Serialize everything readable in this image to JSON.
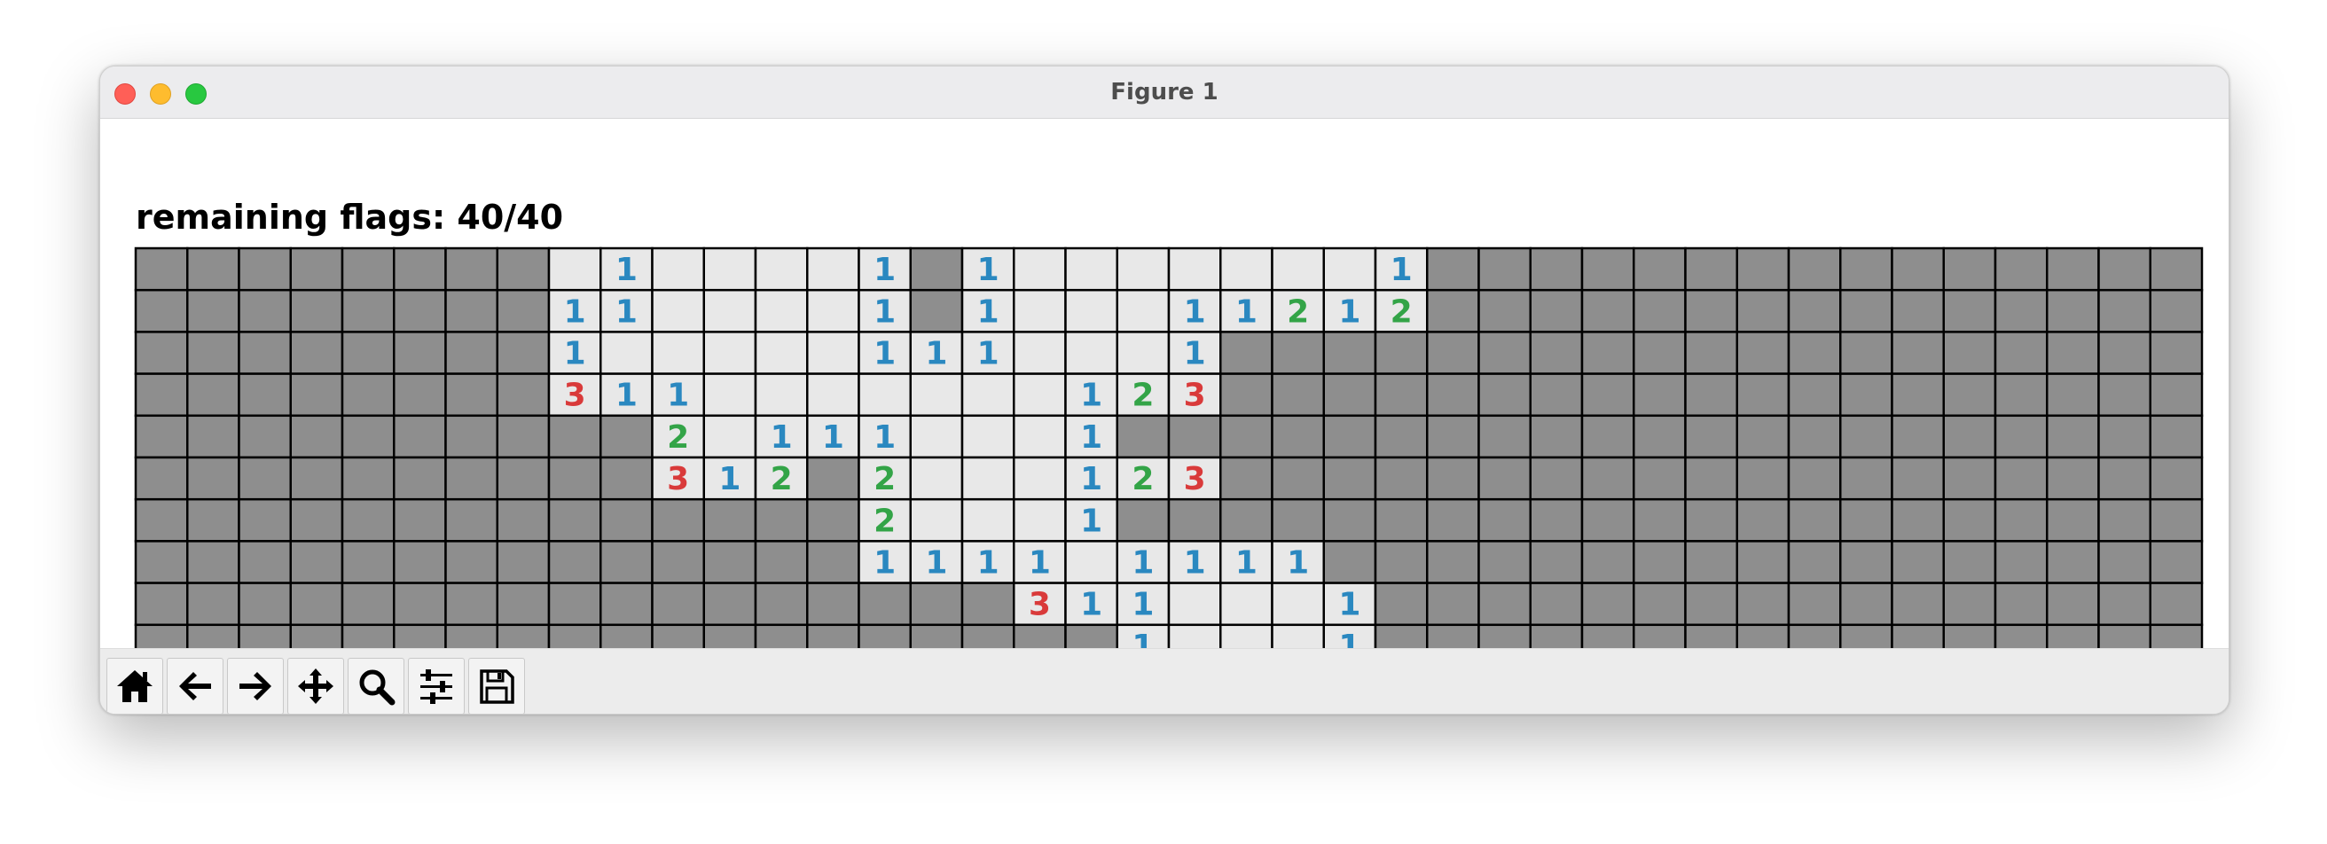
{
  "window": {
    "title": "Figure 1"
  },
  "status": {
    "flags_label": "remaining flags: 40/40"
  },
  "board": {
    "rows": [
      "########.1....1#1.......1###############",
      "########11....1#1...11212###############",
      "########1.....111...1###################",
      "########311.......123###################",
      "##########2.111...1#####################",
      "##########312#2...123###################",
      "##############2...1#####################",
      "##############1111.1111#################",
      "#################311...1################",
      "###################1...1################"
    ],
    "colors": {
      "covered": "#8e8e8e",
      "revealed": "#e8e8e8",
      "grid": "#000000",
      "n1": "#2a88c0",
      "n2": "#33a447",
      "n3": "#d93a3a"
    }
  },
  "toolbar": {
    "buttons": [
      {
        "name": "home-button",
        "icon": "home-icon"
      },
      {
        "name": "back-button",
        "icon": "arrow-left-icon"
      },
      {
        "name": "forward-button",
        "icon": "arrow-right-icon"
      },
      {
        "name": "pan-button",
        "icon": "move-icon"
      },
      {
        "name": "zoom-button",
        "icon": "magnifier-icon"
      },
      {
        "name": "configure-subplots-button",
        "icon": "sliders-icon"
      },
      {
        "name": "save-button",
        "icon": "floppy-disk-icon"
      }
    ]
  }
}
